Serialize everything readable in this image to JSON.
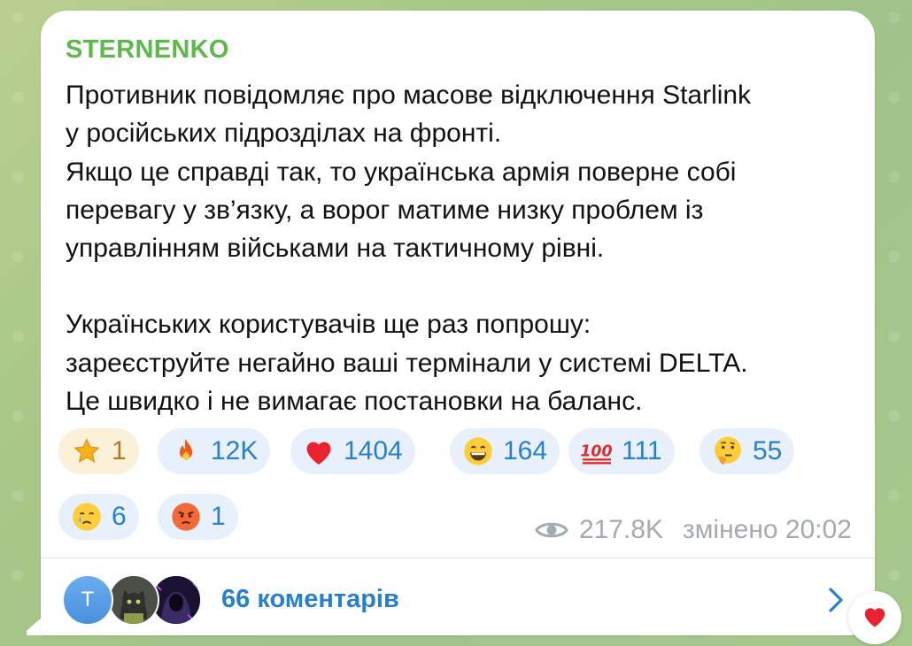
{
  "post": {
    "channel_name": "STERNENKO",
    "lines": [
      "Противник повідомляє про масове відключення Starlink",
      "у російських підрозділах на фронті.",
      "Якщо це справді так, то українська армія поверне собі",
      "перевагу у зв’язку, а ворог матиме низку проблем із",
      "управлінням військами на тактичному рівні.",
      "Українських користувачів ще раз попрошу:",
      "зареєструйте негайно ваші термінали у системі DELTA.",
      "Це швидко і не вимагає постановки на баланс."
    ]
  },
  "reactions": [
    {
      "emoji": "star-icon",
      "count": "1",
      "active": true
    },
    {
      "emoji": "fire-icon",
      "count": "12K"
    },
    {
      "emoji": "heart-icon",
      "count": "1404"
    },
    {
      "emoji": "grinning-face-icon",
      "count": "164"
    },
    {
      "emoji": "hundred-points-icon",
      "count": "111"
    },
    {
      "emoji": "thinking-face-icon",
      "count": "55"
    },
    {
      "emoji": "crying-face-icon",
      "count": "6"
    },
    {
      "emoji": "angry-face-icon",
      "count": "1"
    }
  ],
  "meta": {
    "views": "217.8K",
    "edited_time": "змінено 20:02"
  },
  "comments": {
    "avatar_letter": "T",
    "label": "66 коментарів"
  },
  "colors": {
    "channel_name": "#5fb84b",
    "link_blue": "#2a7fc9",
    "meta_gray": "#a3aab1",
    "reaction_bg": "#e8f1fb",
    "reaction_active_bg": "#fbf1d9"
  }
}
